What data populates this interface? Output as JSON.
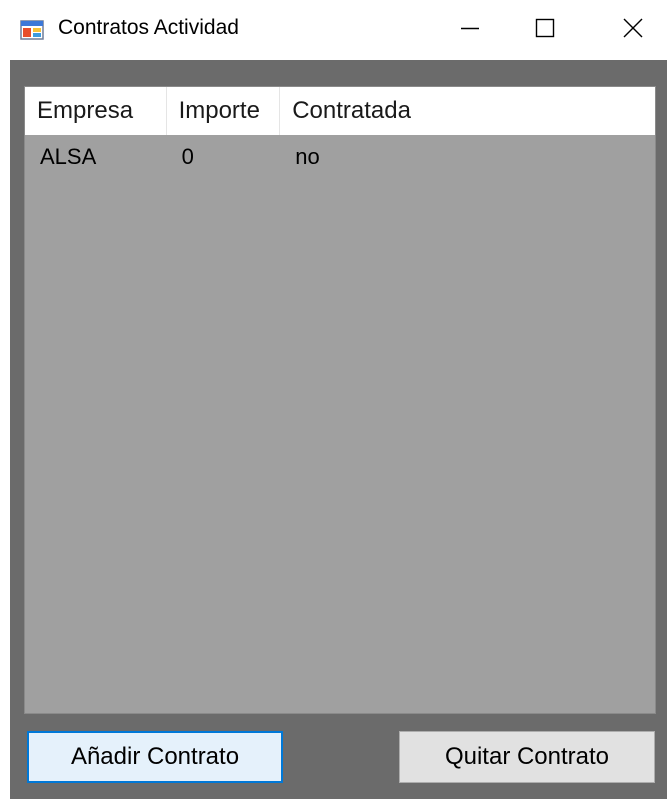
{
  "window": {
    "title": "Contratos Actividad",
    "icon": "windows-form-icon",
    "controls": {
      "minimize_icon": "minimize-icon",
      "maximize_icon": "maximize-icon",
      "close_icon": "close-icon"
    }
  },
  "listview": {
    "columns": [
      "Empresa",
      "Importe",
      "Contratada"
    ],
    "rows": [
      [
        "ALSA",
        "0",
        "no"
      ]
    ]
  },
  "buttons": {
    "add_label": "Añadir Contrato",
    "remove_label": "Quitar Contrato"
  },
  "colors": {
    "client_background": "#6b6b6b",
    "list_background": "#a0a0a0",
    "focus_border": "#0078d7"
  }
}
